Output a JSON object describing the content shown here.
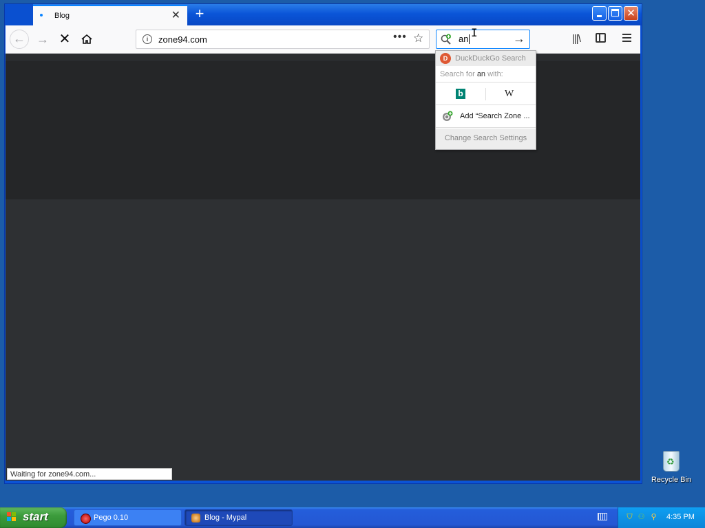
{
  "browser": {
    "tab": {
      "title": "Blog",
      "close_glyph": "✕"
    },
    "new_tab_glyph": "+",
    "url": "zone94.com",
    "search_query": "an",
    "status_text": "Waiting for zone94.com..."
  },
  "search_dropdown": {
    "engine_header": "DuckDuckGo Search",
    "search_for_prefix": "Search for",
    "search_for_query": "an",
    "search_for_suffix": "with:",
    "engines": [
      "bing",
      "wikipedia"
    ],
    "add_engine_label": "Add “Search Zone ...",
    "settings_label": "Change Search Settings"
  },
  "desktop": {
    "recycle_bin_label": "Recycle Bin"
  },
  "taskbar": {
    "start_label": "start",
    "tasks": [
      {
        "label": "Pego 0.10",
        "active": false
      },
      {
        "label": "Blog - Mypal",
        "active": true
      }
    ],
    "clock": "4:35 PM"
  }
}
